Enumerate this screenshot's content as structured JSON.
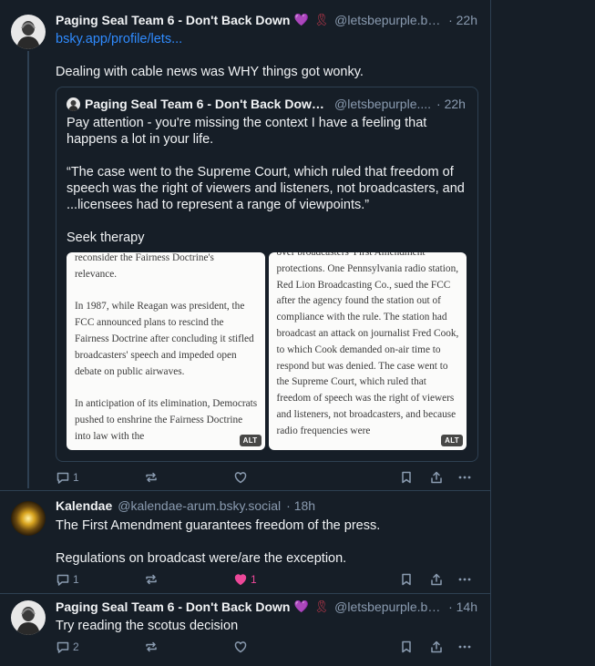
{
  "posts": [
    {
      "author": "Paging Seal Team 6 - Don't Back Down",
      "heart_emoji": "💜",
      "ribbon_emoji": "🎗",
      "handle": "@letsbepurple.bsk...",
      "time": "· 22h",
      "link_text": "bsky.app/profile/lets...",
      "text": "Dealing with cable news was WHY things got wonky.",
      "quote": {
        "author": "Paging Seal Team 6 - Don't Back Down...",
        "handle": "@letsbepurple....",
        "time": "· 22h",
        "text1": "Pay attention - you're missing the context   I have a feeling that happens a lot in your life.",
        "text2": "“The case went to the Supreme Court, which ruled that freedom of speech was the right of viewers and listeners, not broadcasters, and ...licensees had to represent a range of viewpoints.”",
        "text3": "Seek therapy",
        "images": [
          {
            "paragraphs": [
              "reconsider the Fairness Doctrine's relevance.",
              "In 1987, while Reagan was president, the FCC announced plans to rescind the Fairness Doctrine after concluding it stifled broadcasters' speech and impeded open debate on public airwaves.",
              "In anticipation of its elimination, Democrats pushed to enshrine the Fairness Doctrine into law with the"
            ],
            "alt_badge": "ALT"
          },
          {
            "paragraphs": [
              "over broadcasters' First Amendment protections. One Pennsylvania radio station, Red Lion Broadcasting Co., sued the FCC after the agency found the station out of compliance with the rule. The station had broadcast an attack on journalist Fred Cook, to which Cook demanded on-air time to respond but was denied. The case went to the Supreme Court, which ruled that freedom of speech was the right of viewers and listeners, not broadcasters, and because radio frequencies were"
            ],
            "alt_badge": "ALT"
          }
        ]
      },
      "actions": {
        "reply_count": "1",
        "repost_count": "",
        "like_count": ""
      }
    },
    {
      "author": "Kalendae",
      "handle": "@kalendae-arum.bsky.social",
      "time": "· 18h",
      "text1": "The First Amendment guarantees freedom of the press.",
      "text2": "Regulations on broadcast were/are the exception.",
      "actions": {
        "reply_count": "1",
        "repost_count": "",
        "like_count": "1",
        "liked": true
      }
    },
    {
      "author": "Paging Seal Team 6 - Don't Back Down",
      "heart_emoji": "💜",
      "ribbon_emoji": "🎗",
      "handle": "@letsbepurple.bsk...",
      "time": "· 14h",
      "text": "Try reading the scotus decision",
      "actions": {
        "reply_count": "2",
        "repost_count": "",
        "like_count": ""
      }
    }
  ],
  "icons": [
    "reply-icon",
    "repost-icon",
    "like-icon",
    "bookmark-icon",
    "share-icon",
    "more-icon"
  ],
  "colors": {
    "background": "#161e27",
    "border": "#2e4052",
    "muted": "#8a9bb0",
    "link": "#2f8bff",
    "like_active": "#ec4899"
  }
}
